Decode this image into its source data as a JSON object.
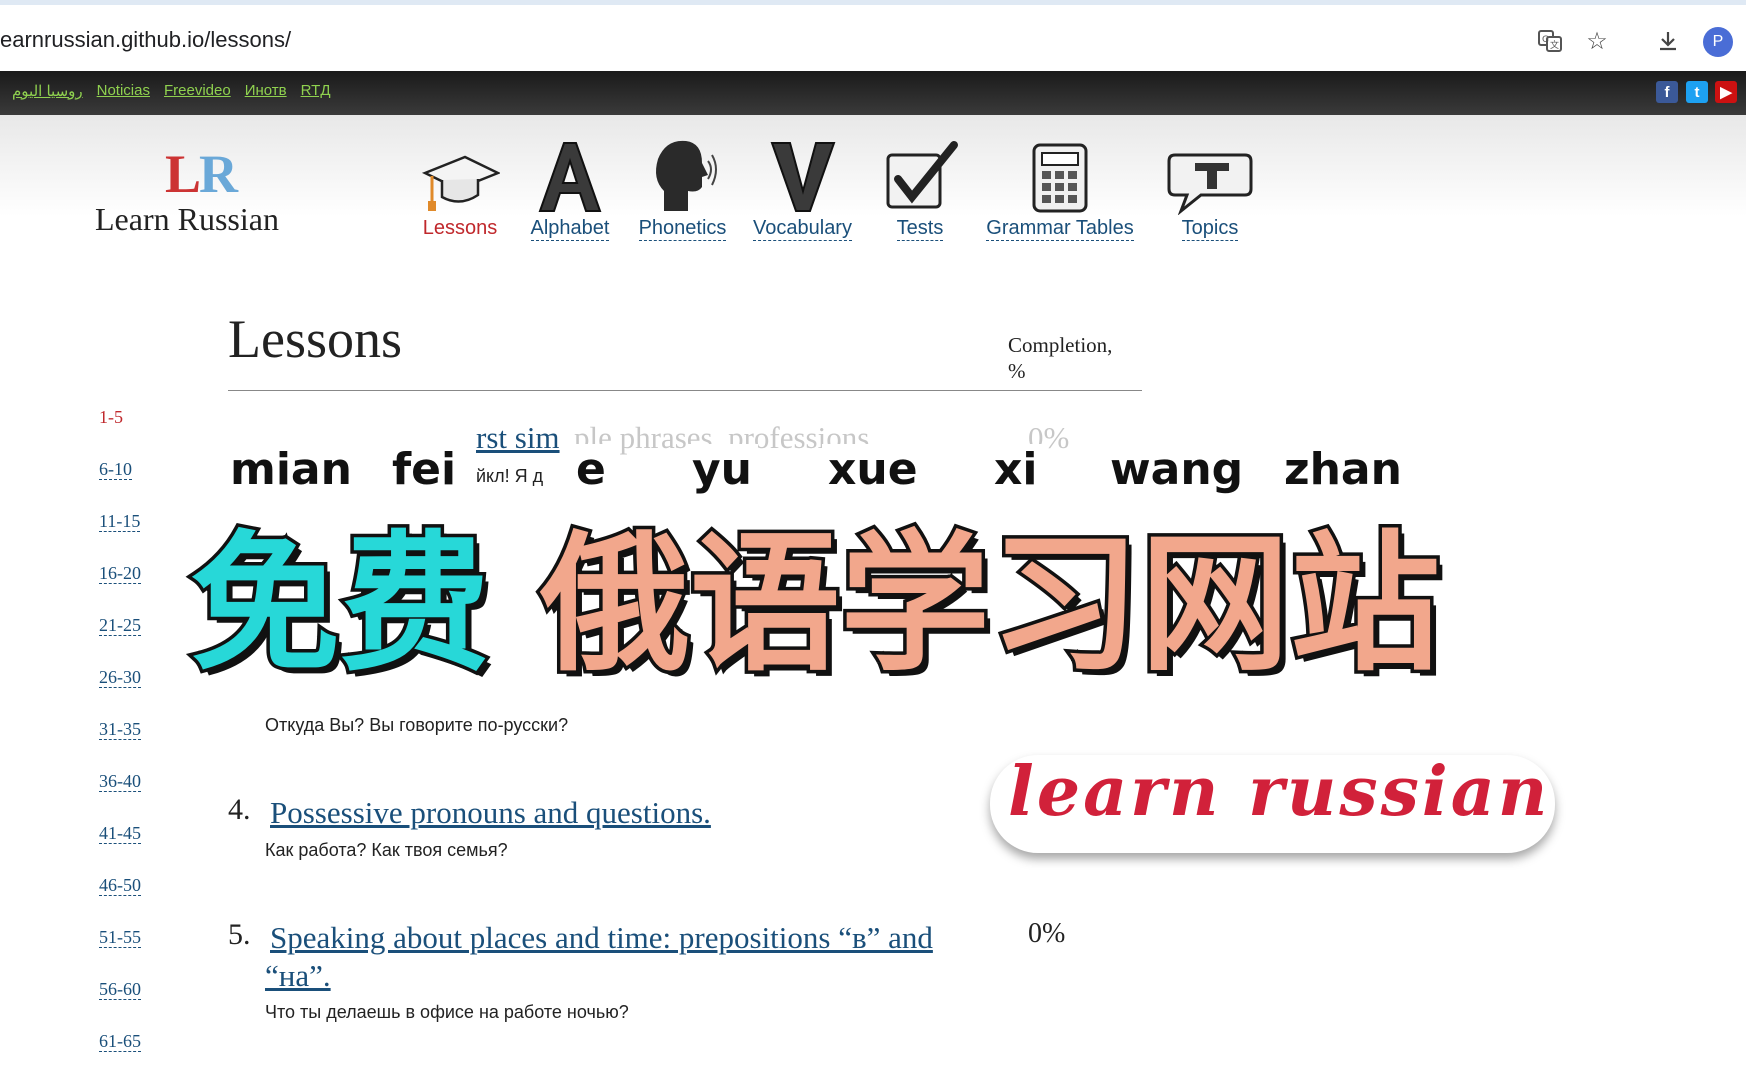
{
  "browser": {
    "url": "earnrussian.github.io/lessons/",
    "icons": [
      "translate-icon",
      "star-icon",
      "download-icon"
    ],
    "profile_initial": "P",
    "profile_color": "#4a6dd6"
  },
  "topbar": {
    "links": [
      "روسيا اليوم",
      "Noticias",
      "Freevideo",
      "Инотв",
      "RTД"
    ],
    "social": {
      "facebook": "f",
      "twitter": "t",
      "youtube": "▶"
    },
    "link_color": "#8fd14f"
  },
  "logo": {
    "mark_l": "L",
    "mark_r": "R",
    "name": "Learn Russian"
  },
  "nav": [
    {
      "label": "Lessons",
      "icon": "graduation-cap-icon",
      "active": true
    },
    {
      "label": "Alphabet",
      "icon": "letter-a-icon",
      "active": false
    },
    {
      "label": "Phonetics",
      "icon": "speaking-head-icon",
      "active": false
    },
    {
      "label": "Vocabulary",
      "icon": "letter-v-icon",
      "active": false
    },
    {
      "label": "Tests",
      "icon": "checkbox-icon",
      "active": false
    },
    {
      "label": "Grammar Tables",
      "icon": "calculator-table-icon",
      "active": false
    },
    {
      "label": "Topics",
      "icon": "speech-bubble-icon",
      "active": false
    }
  ],
  "sidebar": {
    "ranges": [
      "1-5",
      "6-10",
      "11-15",
      "16-20",
      "21-25",
      "26-30",
      "31-35",
      "36-40",
      "41-45",
      "46-50",
      "51-55",
      "56-60",
      "61-65"
    ],
    "active": "1-5"
  },
  "main": {
    "title": "Lessons",
    "completion_header_line1": "Completion,",
    "completion_header_line2": "%",
    "partial_lesson": {
      "link_fragment": "rst sim",
      "faded_fragment": "ple phrases, professions",
      "pct_fragment": "0%",
      "sub_fragment": "йкл! Я д"
    },
    "lesson3_sub": "Откуда Вы? Вы говорите по-русски?",
    "lessons": [
      {
        "number": "4.",
        "title": "Possessive pronouns and questions.",
        "sub": "Как работа? Как твоя семья?",
        "pct": ""
      },
      {
        "number": "5.",
        "title_line1": "Speaking about places and time: prepositions “в” and",
        "title_line2": "“на”.",
        "sub": "Что ты делаешь в офисе на работе ночью?",
        "pct": "0%"
      }
    ]
  },
  "overlay": {
    "pinyin": [
      "mian",
      "fei",
      "e",
      "yu",
      "xue",
      "xi",
      "wang",
      "zhan"
    ],
    "title_part1": "免费",
    "title_part2": "俄语学习网站",
    "title_color1": "#27d8d8",
    "title_color2": "#f2a78c",
    "sticker_text": "learn russian",
    "sticker_color": "#d1213a"
  }
}
